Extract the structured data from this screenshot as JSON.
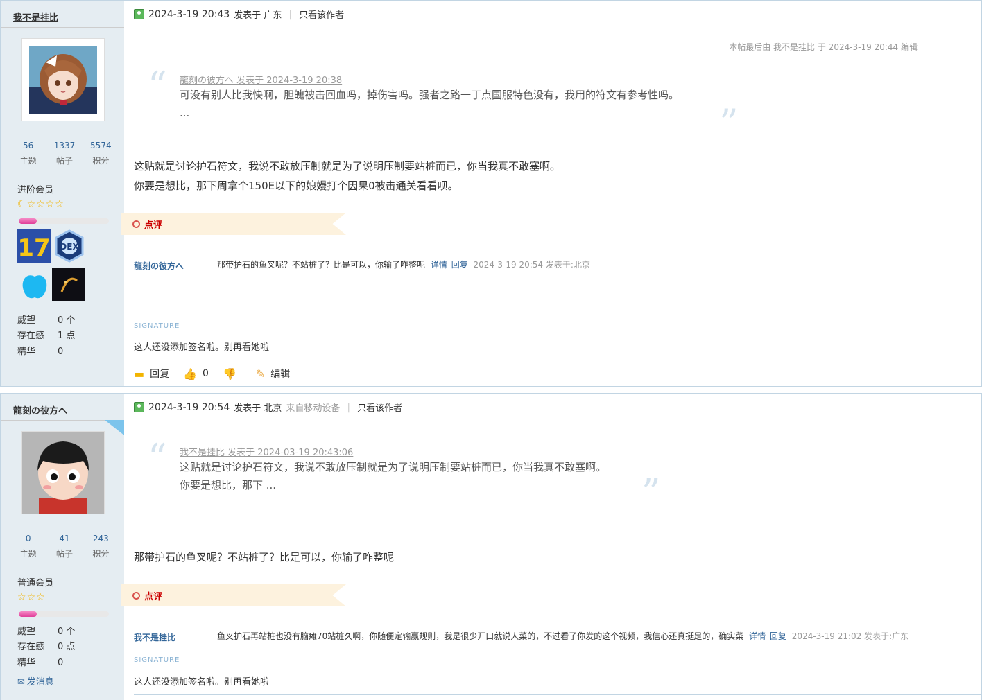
{
  "posts": [
    {
      "user": {
        "name": "我不是挂比",
        "stats": [
          {
            "num": "56",
            "label": "主题"
          },
          {
            "num": "1337",
            "label": "帖子"
          },
          {
            "num": "5574",
            "label": "积分"
          }
        ],
        "group": "进阶会员",
        "progress": 0.2,
        "props": [
          {
            "k": "威望",
            "v": "0 个"
          },
          {
            "k": "存在感",
            "v": "1 点"
          },
          {
            "k": "精华",
            "v": "0"
          }
        ]
      },
      "header": {
        "date": "2024-3-19 20:43",
        "posted_in": "发表于 广东",
        "only_author": "只看该作者"
      },
      "edited": "本帖最后由 我不是挂比 于 2024-3-19 20:44 编辑",
      "quote": {
        "head": "龍刻の彼方へ 发表于 2024-3-19 20:38",
        "lines": [
          "可没有别人比我快啊，胆魄被击回血吗，掉伤害吗。强者之路一丁点国服特色没有，我用的符文有参考性吗。",
          "..."
        ]
      },
      "body": [
        "这贴就是讨论护石符文，我说不敢放压制就是为了说明压制要站桩而已，你当我真不敢塞啊。",
        "你要是想比，那下周拿个150E以下的娘嫚打个因果0被击通关看看呗。"
      ],
      "comment_tab": "点评",
      "comment": {
        "author": "龍刻の彼方へ",
        "text": "那带护石的鱼叉呢？不站桩了？比是可以，你输了咋整呢",
        "detail": "详情",
        "reply": "回复",
        "meta": "2024-3-19 20:54 发表于:北京"
      },
      "signature_label": "SIGNATURE",
      "signature": "这人还没添加签名啦。别再看她啦",
      "actions": {
        "reply": "回复",
        "likes": "0",
        "edit": "编辑"
      }
    },
    {
      "user": {
        "name": "龍刻の彼方へ",
        "stats": [
          {
            "num": "0",
            "label": "主题"
          },
          {
            "num": "41",
            "label": "帖子"
          },
          {
            "num": "243",
            "label": "积分"
          }
        ],
        "group": "普通会员",
        "progress": 0.2,
        "props": [
          {
            "k": "威望",
            "v": "0 个"
          },
          {
            "k": "存在感",
            "v": "0 点"
          },
          {
            "k": "精华",
            "v": "0"
          }
        ],
        "pm": "发消息"
      },
      "header": {
        "date": "2024-3-19 20:54",
        "posted_in": "发表于 北京",
        "mobile": "来自移动设备",
        "only_author": "只看该作者"
      },
      "quote": {
        "head": "我不是挂比 发表于 2024-03-19 20:43:06",
        "lines": [
          "这贴就是讨论护石符文，我说不敢放压制就是为了说明压制要站桩而已，你当我真不敢塞啊。",
          "你要是想比，那下 ..."
        ]
      },
      "body": [
        "那带护石的鱼叉呢？不站桩了？比是可以，你输了咋整呢"
      ],
      "comment_tab": "点评",
      "comment": {
        "author": "我不是挂比",
        "text": "鱼叉护石再站桩也没有脑瘫70站桩久啊，你随便定输赢规则，我是很少开口就说人菜的，不过看了你发的这个视频，我信心还真挺足的，确实菜",
        "detail": "详情",
        "reply": "回复",
        "meta": "2024-3-19 21:02 发表于:广东"
      },
      "signature_label": "SIGNATURE",
      "signature": "这人还没添加签名啦。别再看她啦"
    }
  ],
  "colors": {
    "link": "#336699",
    "border": "#c2d5e3",
    "sidebar": "#e5edf2",
    "comment_tab": "#fdf2de"
  }
}
